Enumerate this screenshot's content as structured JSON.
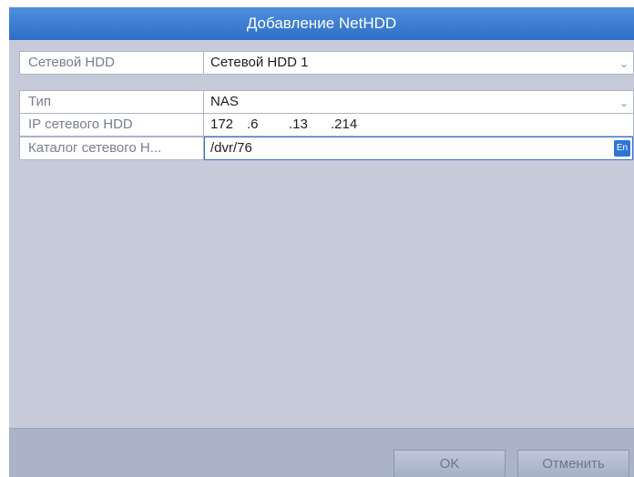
{
  "dialog": {
    "title": "Добавление NetHDD"
  },
  "form": {
    "net_hdd": {
      "label": "Сетевой HDD",
      "value": "Сетевой HDD 1"
    },
    "type": {
      "label": "Тип",
      "value": "NAS"
    },
    "ip": {
      "label": "IP сетевого HDD",
      "octets": [
        "172",
        ".6",
        ".13",
        ".214"
      ]
    },
    "directory": {
      "label": "Каталог сетевого Н...",
      "value": "/dvr/76",
      "ime_badge": "En"
    }
  },
  "buttons": {
    "ok": "OK",
    "cancel": "Отменить"
  },
  "colors": {
    "title_bar": "#3a7bd5",
    "panel_bg": "#c7cbd9",
    "footer_bg": "#aab3c8",
    "active_border": "#2f74d6"
  },
  "icons": {
    "dropdown": "chevron-down-icon",
    "input_method": "en-input-icon"
  }
}
